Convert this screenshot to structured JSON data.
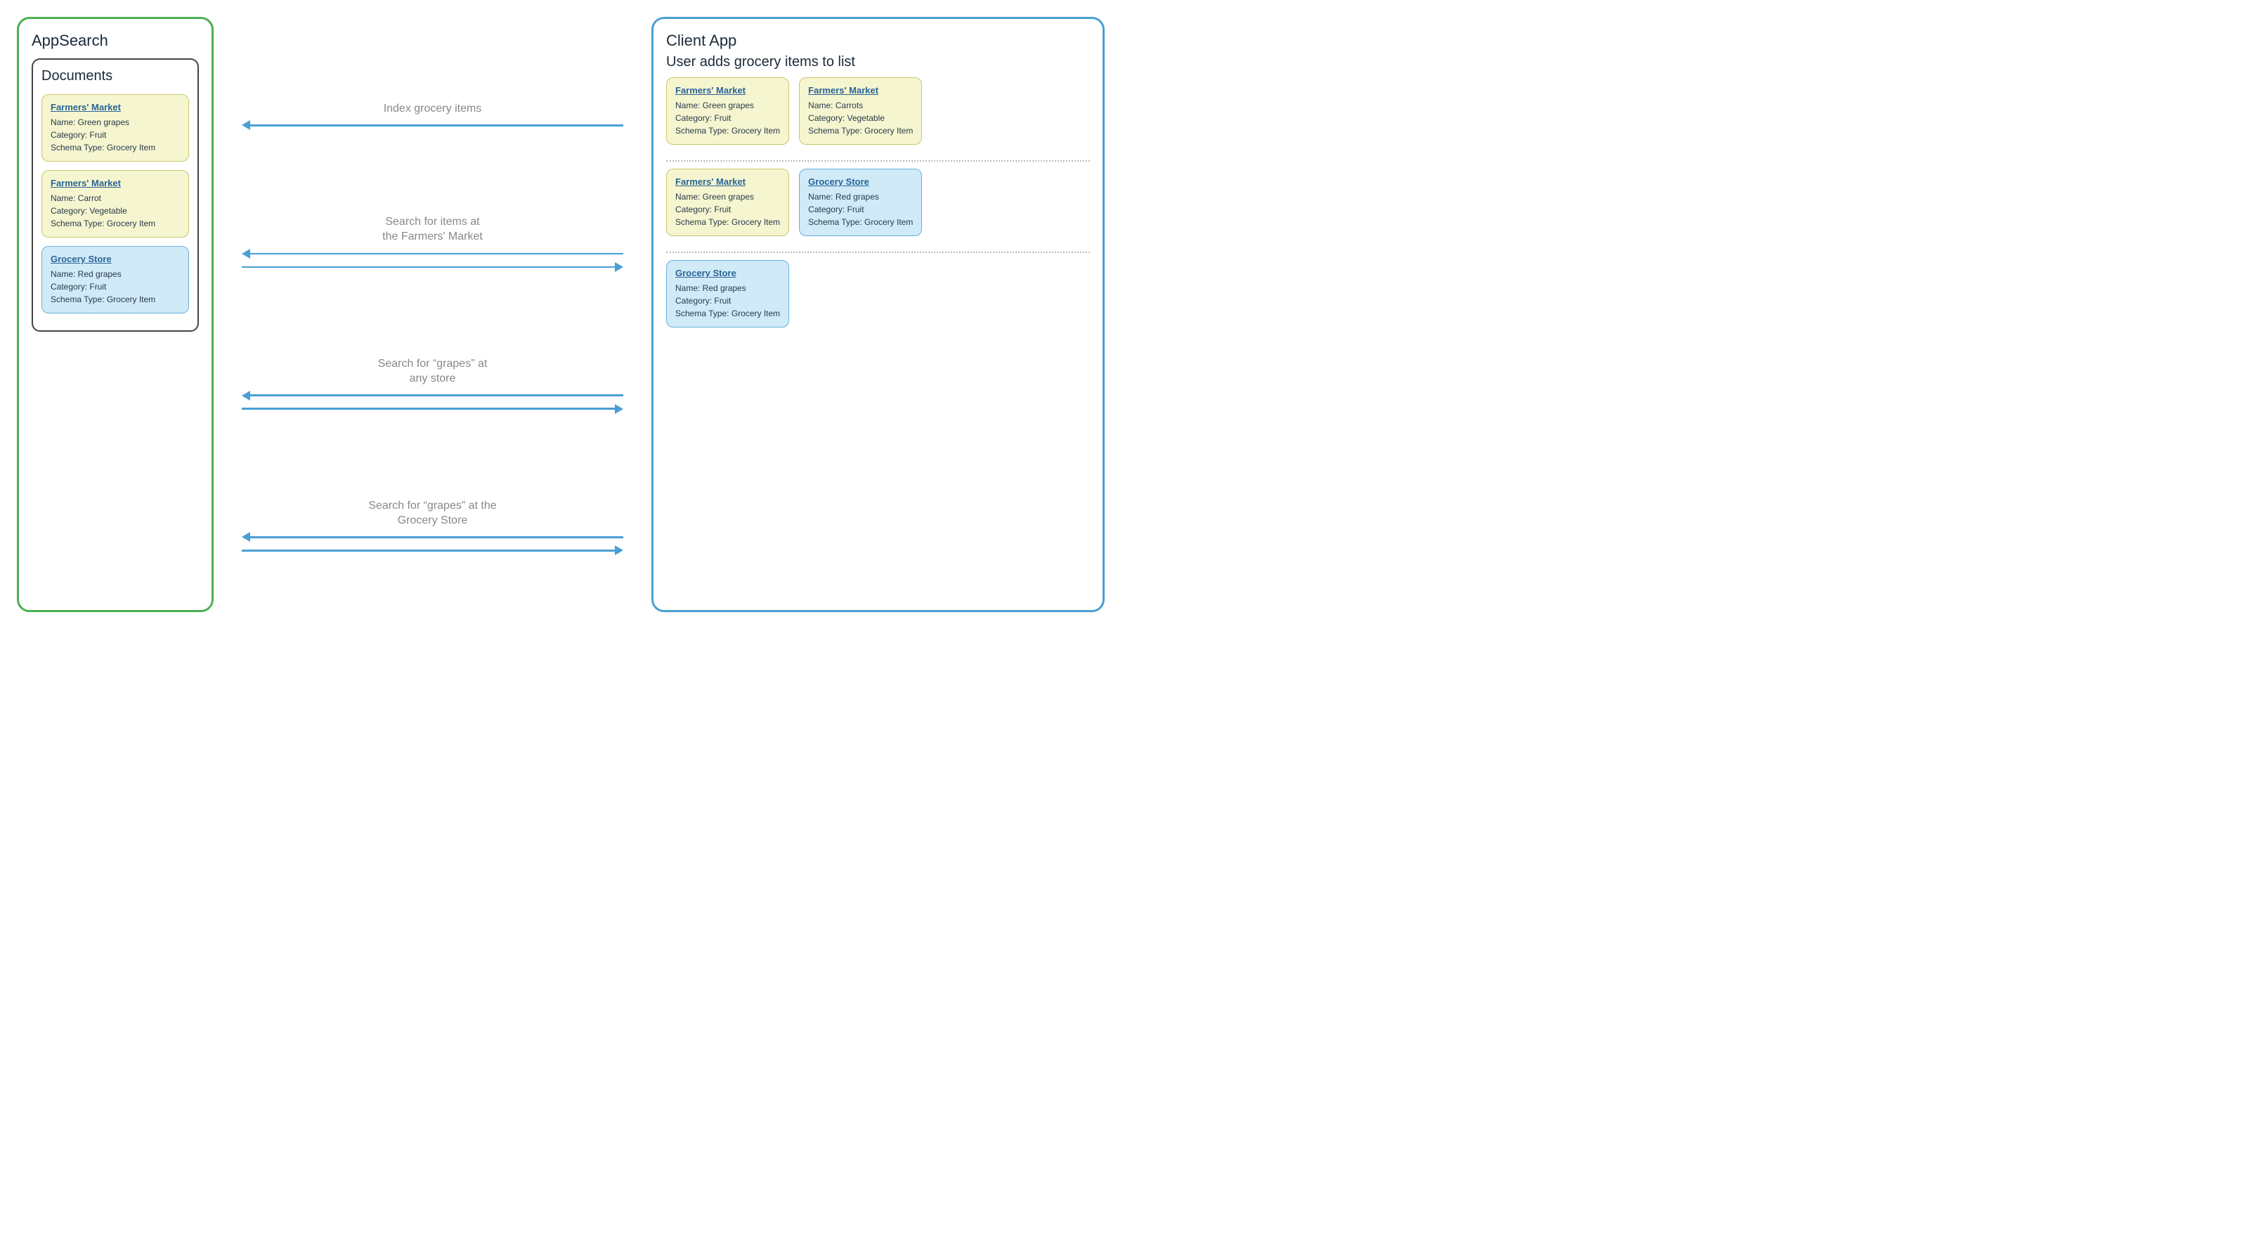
{
  "appsearch": {
    "title": "AppSearch",
    "documents": {
      "title": "Documents",
      "cards": [
        {
          "title": "Farmers' Market",
          "type": "yellow",
          "lines": [
            "Name: Green grapes",
            "Category: Fruit",
            "Schema Type: Grocery Item"
          ]
        },
        {
          "title": "Farmers' Market",
          "type": "yellow",
          "lines": [
            "Name: Carrot",
            "Category: Vegetable",
            "Schema Type: Grocery Item"
          ]
        },
        {
          "title": "Grocery Store",
          "type": "blue",
          "lines": [
            "Name: Red grapes",
            "Category: Fruit",
            "Schema Type: Grocery Item"
          ]
        }
      ]
    }
  },
  "arrows": [
    {
      "label": "Index grocery items",
      "has_right": false,
      "has_left": true
    },
    {
      "label": "Search for items at\nthe Farmers' Market",
      "has_right": true,
      "has_left": true
    },
    {
      "label": "Search for “grapes” at\nany store",
      "has_right": true,
      "has_left": true
    },
    {
      "label": "Search for “grapes” at the\nGrocery Store",
      "has_right": true,
      "has_left": true
    }
  ],
  "client": {
    "title": "Client App",
    "section_title": "User adds grocery items to list",
    "sections": [
      {
        "cards": [
          {
            "title": "Farmers' Market",
            "type": "yellow",
            "lines": [
              "Name: Green grapes",
              "Category: Fruit",
              "Schema Type: Grocery Item"
            ]
          },
          {
            "title": "Farmers' Market",
            "type": "yellow",
            "lines": [
              "Name: Carrots",
              "Category: Vegetable",
              "Schema Type: Grocery Item"
            ]
          }
        ]
      },
      {
        "cards": [
          {
            "title": "Farmers' Market",
            "type": "yellow",
            "lines": [
              "Name: Green grapes",
              "Category: Fruit",
              "Schema Type: Grocery Item"
            ]
          },
          {
            "title": "Grocery Store",
            "type": "blue",
            "lines": [
              "Name: Red grapes",
              "Category: Fruit",
              "Schema Type: Grocery Item"
            ]
          }
        ]
      },
      {
        "cards": [
          {
            "title": "Grocery Store",
            "type": "blue",
            "lines": [
              "Name: Red grapes",
              "Category: Fruit",
              "Schema Type: Grocery Item"
            ]
          }
        ]
      }
    ]
  }
}
